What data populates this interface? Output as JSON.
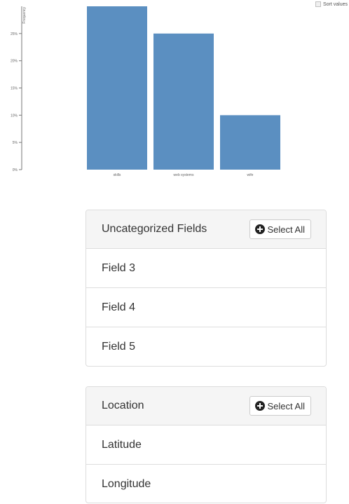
{
  "chart_data": {
    "type": "bar",
    "categories": [
      "skills",
      "web systems",
      "wife"
    ],
    "values": [
      30,
      25,
      10
    ],
    "ylabel": "Frequency",
    "ylim": [
      0,
      30
    ],
    "yticks": [
      0,
      5,
      10,
      15,
      20,
      25
    ],
    "ytick_labels": [
      "0%",
      "5%",
      "10%",
      "15%",
      "20%",
      "25%"
    ],
    "bar_color": "#5b8fc1",
    "grid": false
  },
  "sort_toggle": {
    "label": "Sort values"
  },
  "panels": [
    {
      "title": "Uncategorized Fields",
      "select_all_label": "Select All",
      "items": [
        "Field 3",
        "Field 4",
        "Field 5"
      ]
    },
    {
      "title": "Location",
      "select_all_label": "Select All",
      "items": [
        "Latitude",
        "Longitude"
      ]
    }
  ]
}
